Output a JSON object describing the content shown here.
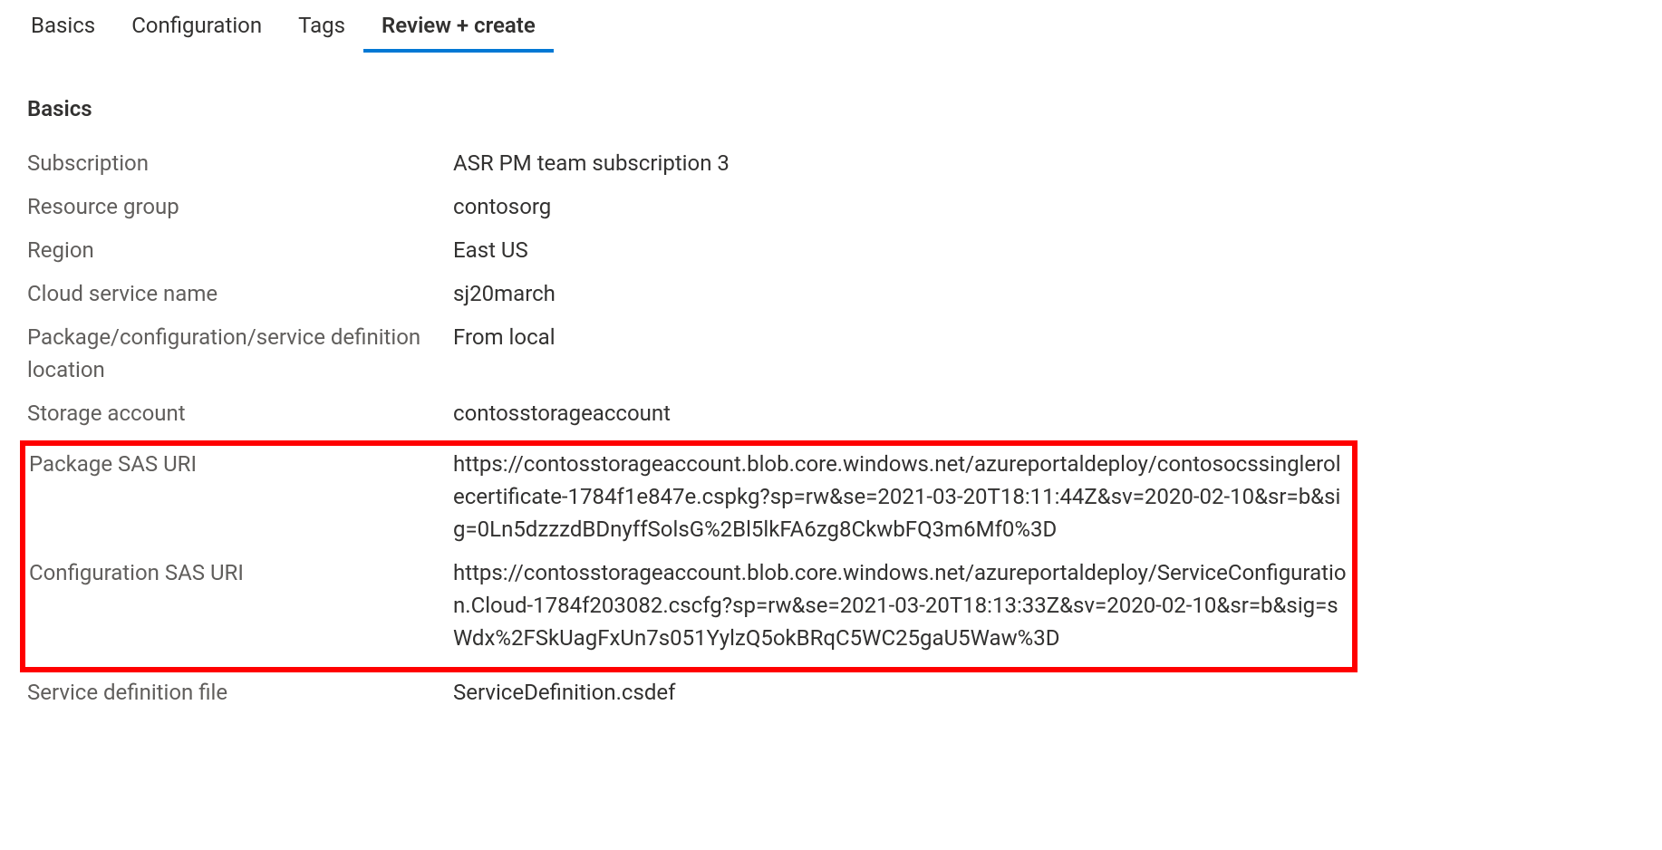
{
  "tabs": [
    {
      "label": "Basics",
      "active": false
    },
    {
      "label": "Configuration",
      "active": false
    },
    {
      "label": "Tags",
      "active": false
    },
    {
      "label": "Review + create",
      "active": true
    }
  ],
  "section": {
    "heading": "Basics",
    "fields": {
      "subscription": {
        "label": "Subscription",
        "value": "ASR PM team subscription 3"
      },
      "resource_group": {
        "label": "Resource group",
        "value": "contosorg"
      },
      "region": {
        "label": "Region",
        "value": "East US"
      },
      "cloud_service_name": {
        "label": "Cloud service name",
        "value": "sj20march"
      },
      "pkg_config_location": {
        "label": "Package/configuration/service definition location",
        "value": "From local"
      },
      "storage_account": {
        "label": "Storage account",
        "value": "contosstorageaccount"
      },
      "package_sas_uri": {
        "label": "Package SAS URI",
        "value": "https://contosstorageaccount.blob.core.windows.net/azureportaldeploy/contosocssinglerolecertificate-1784f1e847e.cspkg?sp=rw&se=2021-03-20T18:11:44Z&sv=2020-02-10&sr=b&sig=0Ln5dzzzdBDnyffSolsG%2Bl5lkFA6zg8CkwbFQ3m6Mf0%3D"
      },
      "configuration_sas_uri": {
        "label": "Configuration SAS URI",
        "value": "https://contosstorageaccount.blob.core.windows.net/azureportaldeploy/ServiceConfiguration.Cloud-1784f203082.cscfg?sp=rw&se=2021-03-20T18:13:33Z&sv=2020-02-10&sr=b&sig=sWdx%2FSkUagFxUn7s051YylzQ5okBRqC5WC25gaU5Waw%3D"
      },
      "service_definition_file": {
        "label": "Service definition file",
        "value": "ServiceDefinition.csdef"
      }
    }
  }
}
